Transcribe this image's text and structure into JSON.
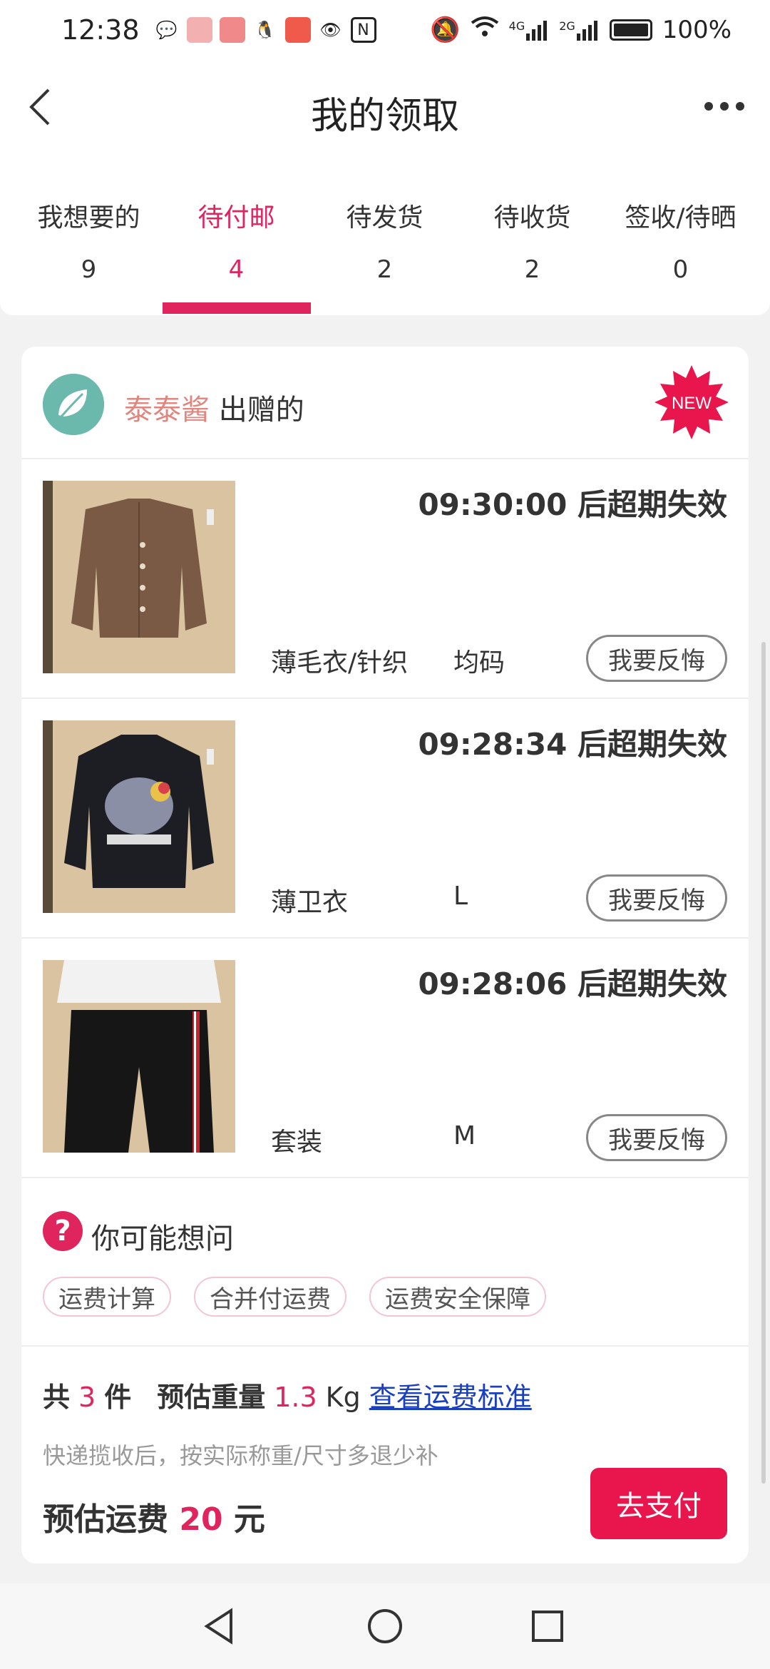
{
  "status_bar": {
    "time": "12:38",
    "battery": "100%",
    "network_a": "4G",
    "network_b": "2G"
  },
  "nav": {
    "title": "我的领取"
  },
  "tabs": [
    {
      "label": "我想要的",
      "count": "9"
    },
    {
      "label": "待付邮",
      "count": "4",
      "active": true
    },
    {
      "label": "待发货",
      "count": "2"
    },
    {
      "label": "待收货",
      "count": "2"
    },
    {
      "label": "签收/待晒",
      "count": "0"
    }
  ],
  "card": {
    "giver_name": "泰泰酱",
    "giver_suffix": "出赠的",
    "new_badge": "NEW",
    "items": [
      {
        "countdown": "09:30:00 后超期失效",
        "type": "薄毛衣/针织",
        "size": "均码",
        "action": "我要反悔"
      },
      {
        "countdown": "09:28:34 后超期失效",
        "type": "薄卫衣",
        "size": "L",
        "action": "我要反悔"
      },
      {
        "countdown": "09:28:06 后超期失效",
        "type": "套装",
        "size": "M",
        "action": "我要反悔"
      }
    ],
    "faq": {
      "icon": "?",
      "title": "你可能想问",
      "chips": [
        "运费计算",
        "合并付运费",
        "运费安全保障"
      ]
    },
    "summary": {
      "total_prefix": "共",
      "total_count": "3",
      "total_suffix": "件",
      "weight_label": "预估重量",
      "weight_value": "1.3",
      "weight_unit": "Kg",
      "link": "查看运费标准",
      "note": "快递揽收后，按实际称重/尺寸多退少补",
      "fee_label": "预估运费",
      "fee_value": "20",
      "fee_unit": "元",
      "pay_button": "去支付"
    }
  },
  "colors": {
    "accent": "#e0245e",
    "pay": "#e8164d",
    "link": "#1a3fbf",
    "giver": "#e0867f"
  }
}
